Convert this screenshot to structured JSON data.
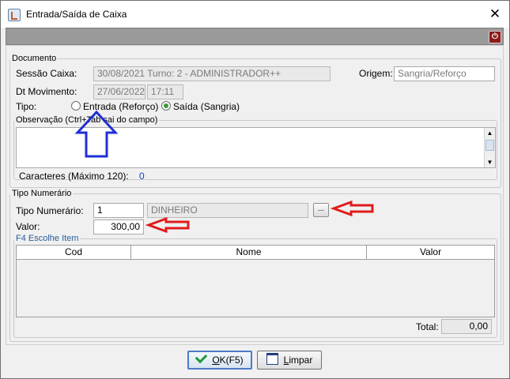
{
  "window": {
    "title": "Entrada/Saída de Caixa",
    "close_glyph": "✕"
  },
  "toolbar": {
    "icon": "power-icon",
    "glyph": "⏻"
  },
  "documento": {
    "legend": "Documento",
    "sessao_label": "Sessão Caixa:",
    "sessao_value": "30/08/2021 Turno: 2 - ADMINISTRADOR++",
    "origem_label": "Origem:",
    "origem_value": "Sangria/Reforço",
    "dt_label": "Dt Movimento:",
    "dt_date": "27/06/2022",
    "dt_time": "17:11",
    "tipo_label": "Tipo:",
    "radio_entrada": "Entrada (Reforço)",
    "radio_saida": "Saída (Sangria)",
    "selected": "saida"
  },
  "observacao": {
    "legend": "Observação (Ctrl+Tab sai do campo)",
    "value": "",
    "caracteres_label": "Caracteres (Máximo 120):",
    "caracteres_count": "0"
  },
  "tipo_numerario": {
    "legend": "Tipo Numerário",
    "tipo_label": "Tipo Numerário:",
    "tipo_code": "1",
    "tipo_name": "DINHEIRO",
    "browse_label": "...",
    "valor_label": "Valor:",
    "valor_value": "300,00"
  },
  "items": {
    "legend": "F4 Escolhe Item",
    "columns": [
      "Cod",
      "Nome",
      "Valor"
    ],
    "rows": [],
    "total_label": "Total:",
    "total_value": "0,00"
  },
  "buttons": {
    "ok_mnemonic": "O",
    "ok_rest": "K(F5)",
    "limpar_mnemonic": "L",
    "limpar_rest": "impar"
  },
  "annotations": {
    "blue_arrow_color": "#1f2fd6",
    "red_arrow_color": "#e01b1b"
  },
  "colors": {
    "legend_blue": "#2a5c9a",
    "counter_blue": "#1a3fc4",
    "toolbar_gray": "#9a9a9a"
  }
}
